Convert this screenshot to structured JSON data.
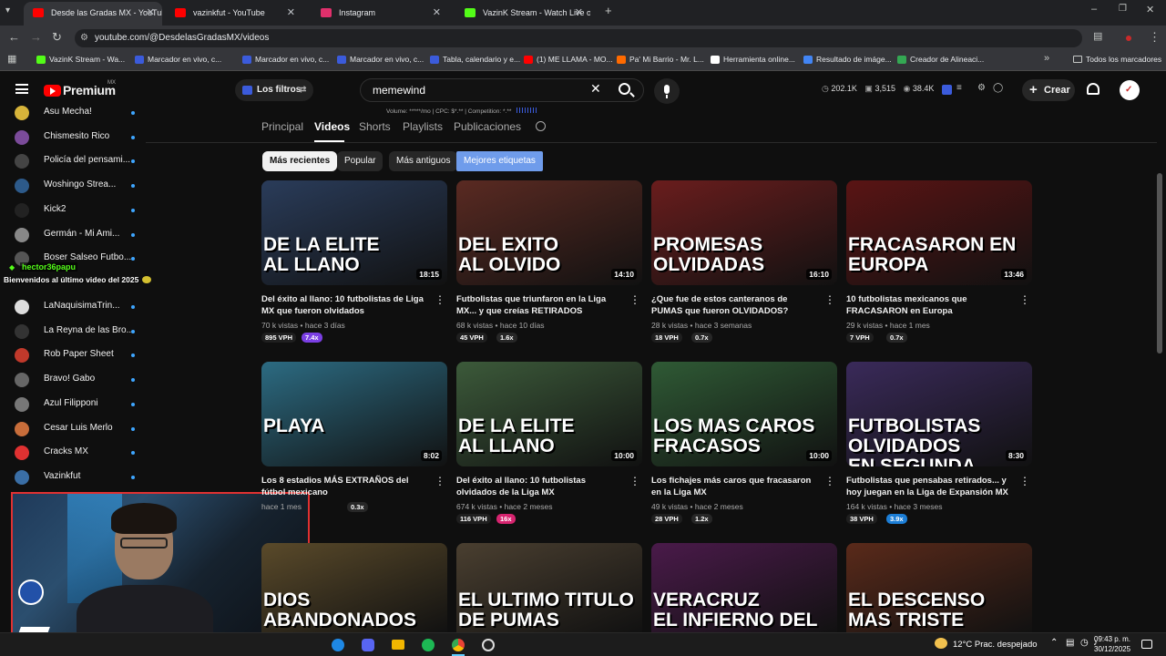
{
  "browser": {
    "tabs": [
      {
        "title": "Desde las Gradas MX - YouTube",
        "color": "#ff0000",
        "active": true
      },
      {
        "title": "vazinkfut - YouTube",
        "color": "#ff0000",
        "active": false
      },
      {
        "title": "Instagram",
        "color": "#e1306c",
        "active": false
      },
      {
        "title": "VazinK Stream - Watch Live on Kick",
        "color": "#53fc18",
        "active": false
      }
    ],
    "url": "youtube.com/@DesdelasGradasMX/videos",
    "bookmarks": [
      {
        "label": "VazinK Stream - Wa...",
        "color": "#53fc18"
      },
      {
        "label": "Marcador en vivo, c...",
        "color": "#3b5bdb"
      },
      {
        "label": "Marcador en vivo, c...",
        "color": "#3b5bdb"
      },
      {
        "label": "Marcador en vivo, c...",
        "color": "#3b5bdb"
      },
      {
        "label": "Tabla, calendario y e...",
        "color": "#3b5bdb"
      },
      {
        "label": "(1) ME LLAMA - MO...",
        "color": "#ff0000"
      },
      {
        "label": "Pa' Mi Barrio - Mr. L...",
        "color": "#ff6a00"
      },
      {
        "label": "Herramienta online...",
        "color": "#ffffff"
      },
      {
        "label": "Resultado de imáge...",
        "color": "#4285f4"
      },
      {
        "label": "Creador de Alineaci...",
        "color": "#34a853"
      }
    ],
    "all_bookmarks_label": "Todos los marcadores"
  },
  "youtube": {
    "logo": "Premium",
    "logo_region": "MX",
    "filters_label": "Los filtros",
    "search_value": "memewind",
    "stats": {
      "subs": "202.1K",
      "videos": "3,515",
      "views": "38.4K"
    },
    "create_label": "Crear",
    "seo_line": "Volume: *****/mo | CPC: $*.** | Competition: *.**",
    "channel_tabs": [
      "Principal",
      "Videos",
      "Shorts",
      "Playlists",
      "Publicaciones"
    ],
    "active_tab": "Videos",
    "chips": [
      "Más recientes",
      "Popular",
      "Más antiguos",
      "Mejores etiquetas"
    ],
    "active_chip": "Más recientes"
  },
  "sidebar": {
    "subscriptions": [
      {
        "name": "Asu Mecha!",
        "color": "#d7b43a"
      },
      {
        "name": "Chismesito Rico",
        "color": "#7b4b9a"
      },
      {
        "name": "Policía del pensami...",
        "color": "#444"
      },
      {
        "name": "Woshingo Strea...",
        "color": "#2d5a8a"
      },
      {
        "name": "Kick2",
        "color": "#222"
      },
      {
        "name": "Germán - Mi Ami...",
        "color": "#888"
      },
      {
        "name": "Boser Salseo Futbo...",
        "color": "#555"
      },
      {
        "name": "LaNaquisimaTrin...",
        "color": "#ddd"
      },
      {
        "name": "La Reyna de las Bro...",
        "color": "#333"
      },
      {
        "name": "Rob Paper Sheet",
        "color": "#c0392b"
      },
      {
        "name": "Bravo! Gabo",
        "color": "#666"
      },
      {
        "name": "Azul Filipponi",
        "color": "#777"
      },
      {
        "name": "Cesar Luis Merlo",
        "color": "#c86d3a"
      },
      {
        "name": "Cracks MX",
        "color": "#e03131"
      },
      {
        "name": "Vazinkfut",
        "color": "#3a6ea5"
      }
    ]
  },
  "chat": {
    "username": "hector36papu",
    "message": "Bienvenidos al último video del 2025"
  },
  "videos": [
    {
      "title": "Del éxito al llano: 10 futbolistas de Liga MX que fueron olvidados",
      "views": "70 k vistas",
      "age": "hace 3 días",
      "vph": "895 VPH",
      "mult": "7.4x",
      "mult_color": "#7b3fe4",
      "duration": "18:15",
      "thumb_text": "DE LA ELITE\nAL LLANO",
      "bg": "#2a3c5a"
    },
    {
      "title": "Futbolistas que triunfaron en la Liga MX... y que creías RETIRADOS",
      "views": "68 k vistas",
      "age": "hace 10 días",
      "vph": "45 VPH",
      "mult": "1.6x",
      "mult_color": "#272727",
      "duration": "14:10",
      "thumb_text": "DEL EXITO\nAL OLVIDO",
      "bg": "#5a2a22"
    },
    {
      "title": "¿Que fue de estos canteranos de PUMAS que fueron OLVIDADOS?",
      "views": "28 k vistas",
      "age": "hace 3 semanas",
      "vph": "18 VPH",
      "mult": "0.7x",
      "mult_color": "#272727",
      "duration": "16:10",
      "thumb_text": "PROMESAS\nOLVIDADAS",
      "bg": "#6a1d1d"
    },
    {
      "title": "10 futbolistas mexicanos que FRACASARON en Europa",
      "views": "29 k vistas",
      "age": "hace 1 mes",
      "vph": "7 VPH",
      "mult": "0.7x",
      "mult_color": "#272727",
      "duration": "13:46",
      "thumb_text": "FRACASARON EN\nEUROPA",
      "bg": "#5a1414"
    },
    {
      "title": "Los 8 estadios MÁS EXTRAÑOS del fútbol mexicano",
      "views": "",
      "age": "hace 1 mes",
      "vph": "",
      "mult": "0.3x",
      "mult_color": "#272727",
      "duration": "8:02",
      "thumb_text": "PLAYA",
      "bg": "#2c6b82"
    },
    {
      "title": "Del éxito al llano: 10 futbolistas olvidados de la Liga MX",
      "views": "674 k vistas",
      "age": "hace 2 meses",
      "vph": "116 VPH",
      "mult": "16x",
      "mult_color": "#d6246f",
      "duration": "10:00",
      "thumb_text": "DE LA ELITE\nAL LLANO",
      "bg": "#3c5a3a"
    },
    {
      "title": "Los fichajes más caros que fracasaron en la Liga MX",
      "views": "49 k vistas",
      "age": "hace 2 meses",
      "vph": "28 VPH",
      "mult": "1.2x",
      "mult_color": "#272727",
      "duration": "10:00",
      "thumb_text": "LOS MAS CAROS\nFRACASOS",
      "bg": "#2f5a35"
    },
    {
      "title": "Futbolistas que pensabas retirados... y hoy juegan en la Liga de Expansión MX",
      "views": "164 k vistas",
      "age": "hace 3 meses",
      "vph": "38 VPH",
      "mult": "3.9x",
      "mult_color": "#1c7ed6",
      "duration": "8:30",
      "thumb_text": "FUTBOLISTAS OLVIDADOS\nEN SEGUNDA DIVISION",
      "bg": "#3a2a5a"
    },
    {
      "title": "",
      "views": "",
      "age": "",
      "vph": "",
      "mult": "",
      "mult_color": "#272727",
      "duration": "",
      "thumb_text": "DIOS ABANDONADOS",
      "bg": "#5a4a2a"
    },
    {
      "title": "",
      "views": "",
      "age": "",
      "vph": "",
      "mult": "",
      "mult_color": "#272727",
      "duration": "",
      "thumb_text": "EL ULTIMO TITULO\nDE PUMAS",
      "bg": "#4a3f30"
    },
    {
      "title": "",
      "views": "",
      "age": "",
      "vph": "",
      "mult": "",
      "mult_color": "#272727",
      "duration": "",
      "thumb_text": "VERACRUZ\nEL INFIERNO DEL DESCENSO",
      "bg": "#4a1a4a"
    },
    {
      "title": "",
      "views": "",
      "age": "",
      "vph": "",
      "mult": "",
      "mult_color": "#272727",
      "duration": "",
      "thumb_text": "EL DESCENSO\nMAS TRISTE",
      "bg": "#5a2a1a"
    }
  ],
  "taskbar": {
    "weather": "12°C  Prac. despejado",
    "time": "09:43 p. m.",
    "date": "30/12/2025"
  }
}
